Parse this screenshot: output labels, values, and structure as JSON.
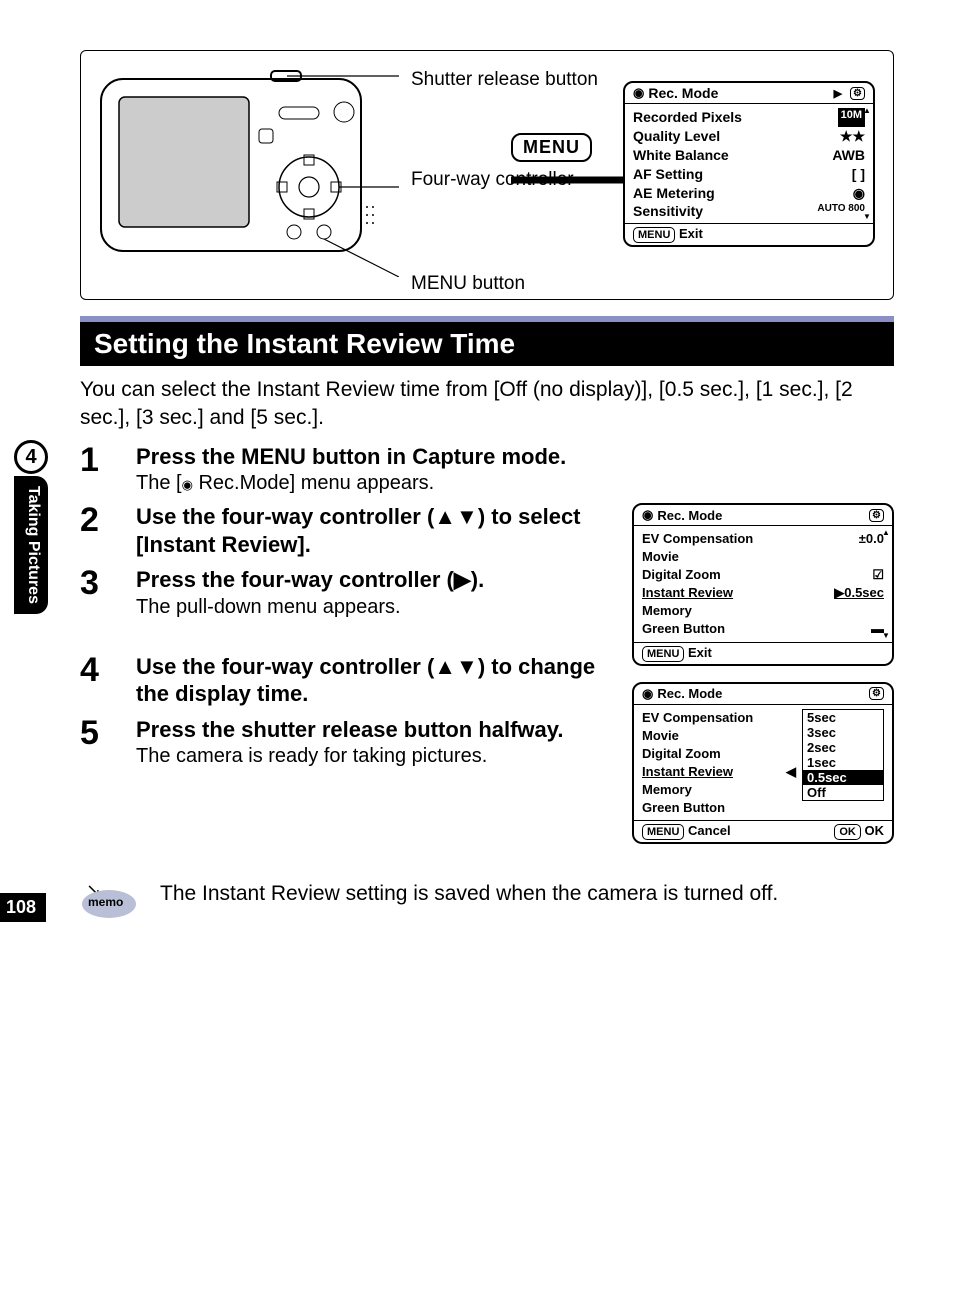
{
  "page_number": "108",
  "chapter_number": "4",
  "side_label": "Taking Pictures",
  "diagram": {
    "callout_shutter": "Shutter release button",
    "callout_fourway": "Four-way controller",
    "callout_menu": "MENU button",
    "menu_button_label": "MENU",
    "lcd": {
      "title": "Rec. Mode",
      "rows": [
        {
          "label": "Recorded Pixels",
          "value": "10M"
        },
        {
          "label": "Quality Level",
          "value": "★★"
        },
        {
          "label": "White Balance",
          "value": "AWB"
        },
        {
          "label": "AF Setting",
          "value": "[  ]"
        },
        {
          "label": "AE Metering",
          "value": "◉"
        },
        {
          "label": "Sensitivity",
          "value": "AUTO 800"
        }
      ],
      "footer": "Exit",
      "footer_btn": "MENU"
    }
  },
  "heading": "Setting the Instant Review Time",
  "lead": "You can select the Instant Review time from [Off (no display)], [0.5 sec.], [1 sec.], [2 sec.], [3 sec.] and [5 sec.].",
  "steps": [
    {
      "n": "1",
      "title": "Press the MENU button in Capture mode.",
      "desc_prefix": "The [",
      "desc_suffix": " Rec.Mode] menu appears."
    },
    {
      "n": "2",
      "title": "Use the four-way controller (▲▼) to select [Instant Review]."
    },
    {
      "n": "3",
      "title": "Press the four-way controller (▶).",
      "desc": "The pull-down menu appears."
    },
    {
      "n": "4",
      "title": "Use the four-way controller (▲▼) to change the display time."
    },
    {
      "n": "5",
      "title": "Press the shutter release button halfway.",
      "desc": "The camera is ready for taking pictures."
    }
  ],
  "lcd2": {
    "title": "Rec. Mode",
    "rows": [
      {
        "label": "EV Compensation",
        "value": "±0.0"
      },
      {
        "label": "Movie",
        "value": ""
      },
      {
        "label": "Digital Zoom",
        "value": "☑"
      },
      {
        "label": "Instant Review",
        "value": "▶0.5sec",
        "highlight": true
      },
      {
        "label": "Memory",
        "value": ""
      },
      {
        "label": "Green Button",
        "value": "▬"
      }
    ],
    "footer": "Exit",
    "footer_btn": "MENU"
  },
  "lcd3": {
    "title": "Rec. Mode",
    "rows": [
      {
        "label": "EV Compensation"
      },
      {
        "label": "Movie"
      },
      {
        "label": "Digital Zoom"
      },
      {
        "label": "Instant Review",
        "arrow": "◀",
        "highlight": true
      },
      {
        "label": "Memory"
      },
      {
        "label": "Green Button"
      }
    ],
    "options": [
      "5sec",
      "3sec",
      "2sec",
      "1sec",
      "0.5sec",
      "Off"
    ],
    "selected_option": "0.5sec",
    "footer_left_btn": "MENU",
    "footer_left": "Cancel",
    "footer_right_btn": "OK",
    "footer_right": "OK"
  },
  "memo": {
    "label": "memo",
    "text": "The Instant Review setting is saved when the camera is turned off."
  }
}
